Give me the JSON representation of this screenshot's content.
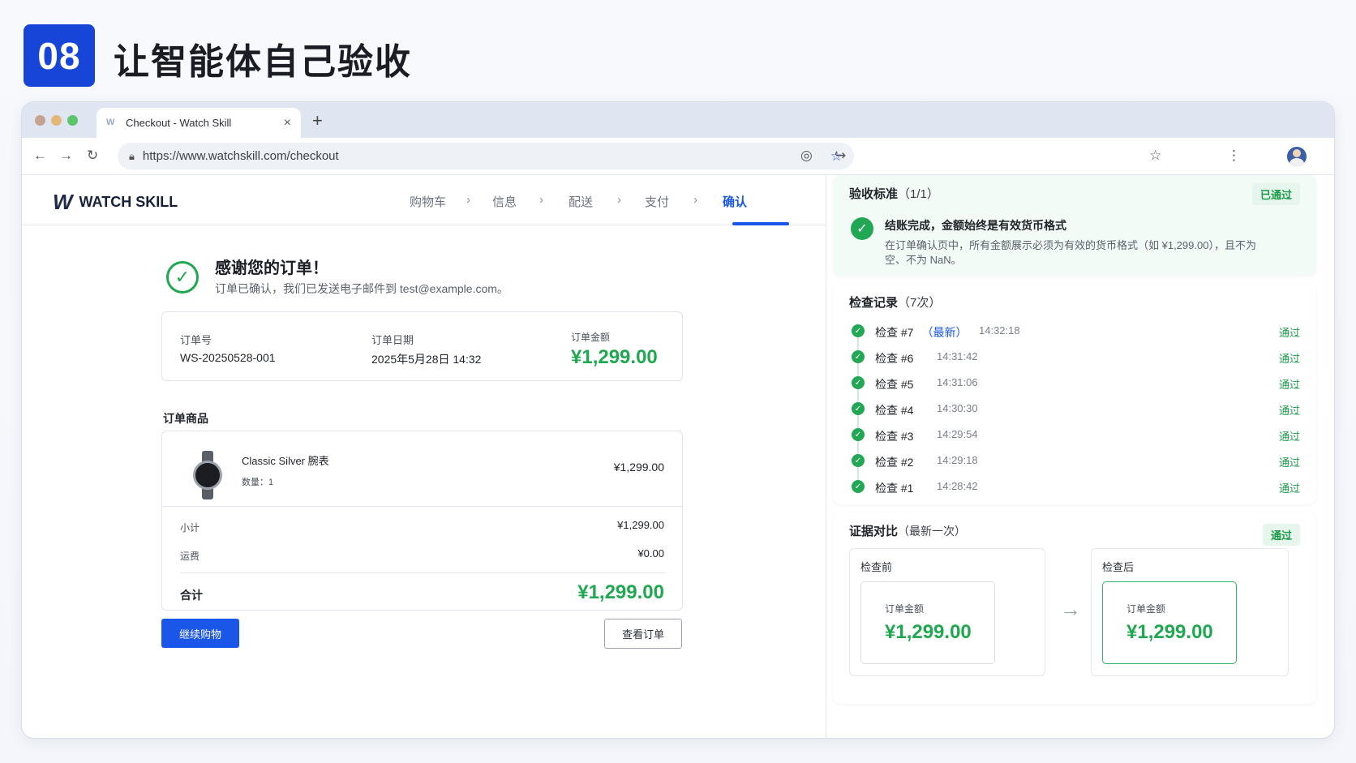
{
  "slide": {
    "number": "08",
    "title": "让智能体自己验收"
  },
  "browser": {
    "tab_title": "Checkout - Watch Skill",
    "tab_close": "×",
    "new_tab": "+",
    "url": "https://www.watchskill.com/checkout"
  },
  "site": {
    "brand": "WATCH SKILL",
    "steps": [
      "购物车",
      "信息",
      "配送",
      "支付",
      "确认"
    ],
    "active_step": "确认"
  },
  "confirmation": {
    "title": "感谢您的订单！",
    "subtitle": "订单已确认，我们已发送电子邮件到 test@example.com。",
    "order_no_label": "订单号",
    "order_no": "WS-20250528-001",
    "order_date_label": "订单日期",
    "order_date": "2025年5月28日 14:32",
    "order_amount_label": "订单金额",
    "order_amount": "¥1,299.00"
  },
  "items": {
    "section_title": "订单商品",
    "product_name": "Classic Silver 腕表",
    "quantity": "数量：1",
    "price": "¥1,299.00",
    "subtotal_label": "小计",
    "subtotal": "¥1,299.00",
    "shipping_label": "运费",
    "shipping": "¥0.00",
    "total_label": "合计",
    "total": "¥1,299.00"
  },
  "actions": {
    "continue": "继续购物",
    "view_order": "查看订单"
  },
  "criteria": {
    "title": "验收标准",
    "count": "（1/1）",
    "badge": "已通过",
    "item_title": "结账完成，金额始终是有效货币格式",
    "item_desc": "在订单确认页中，所有金额展示必须为有效的货币格式（如 ¥1,299.00），且不为空、不为 NaN。"
  },
  "records": {
    "title": "检查记录",
    "count": "（7次）",
    "latest_tag": "（最新）",
    "items": [
      {
        "label": "检查 #7",
        "time": "14:32:18",
        "status": "通过"
      },
      {
        "label": "检查 #6",
        "time": "14:31:42",
        "status": "通过"
      },
      {
        "label": "检查 #5",
        "time": "14:31:06",
        "status": "通过"
      },
      {
        "label": "检查 #4",
        "time": "14:30:30",
        "status": "通过"
      },
      {
        "label": "检查 #3",
        "time": "14:29:54",
        "status": "通过"
      },
      {
        "label": "检查 #2",
        "time": "14:29:18",
        "status": "通过"
      },
      {
        "label": "检查 #1",
        "time": "14:28:42",
        "status": "通过"
      }
    ]
  },
  "evidence": {
    "title": "证据对比",
    "sub": "（最新一次）",
    "badge": "通过",
    "before_label": "检查前",
    "after_label": "检查后",
    "amount_label": "订单金额",
    "before_amount": "¥1,299.00",
    "after_amount": "¥1,299.00"
  },
  "colors": {
    "accent": "#1a56e8",
    "success": "#1fa84f",
    "slide_badge": "#1745d8"
  }
}
